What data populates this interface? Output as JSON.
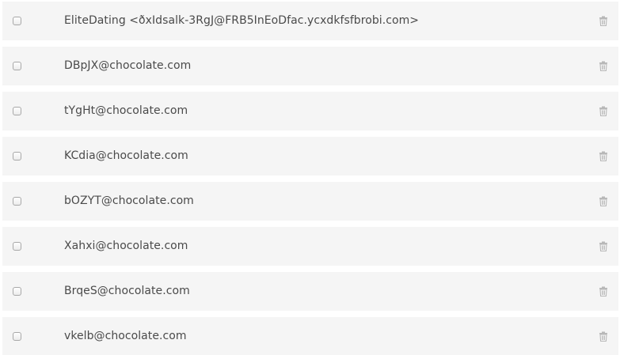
{
  "emails": [
    {
      "label": "EliteDating <ðxIdsalk-3RgJ@FRB5InEoDfac.ycxdkfsfbrobi.com>",
      "checked": false
    },
    {
      "label": "DBpJX@chocolate.com",
      "checked": false
    },
    {
      "label": "tYgHt@chocolate.com",
      "checked": false
    },
    {
      "label": "KCdia@chocolate.com",
      "checked": false
    },
    {
      "label": "bOZYT@chocolate.com",
      "checked": false
    },
    {
      "label": "Xahxi@chocolate.com",
      "checked": false
    },
    {
      "label": "BrqeS@chocolate.com",
      "checked": false
    },
    {
      "label": "vkelb@chocolate.com",
      "checked": false
    }
  ],
  "icons": {
    "select": "checkbox",
    "delete": "trash-icon"
  },
  "colors": {
    "row_background": "#f5f5f5",
    "text": "#4a4a4a",
    "icon": "#b8b8b8"
  }
}
